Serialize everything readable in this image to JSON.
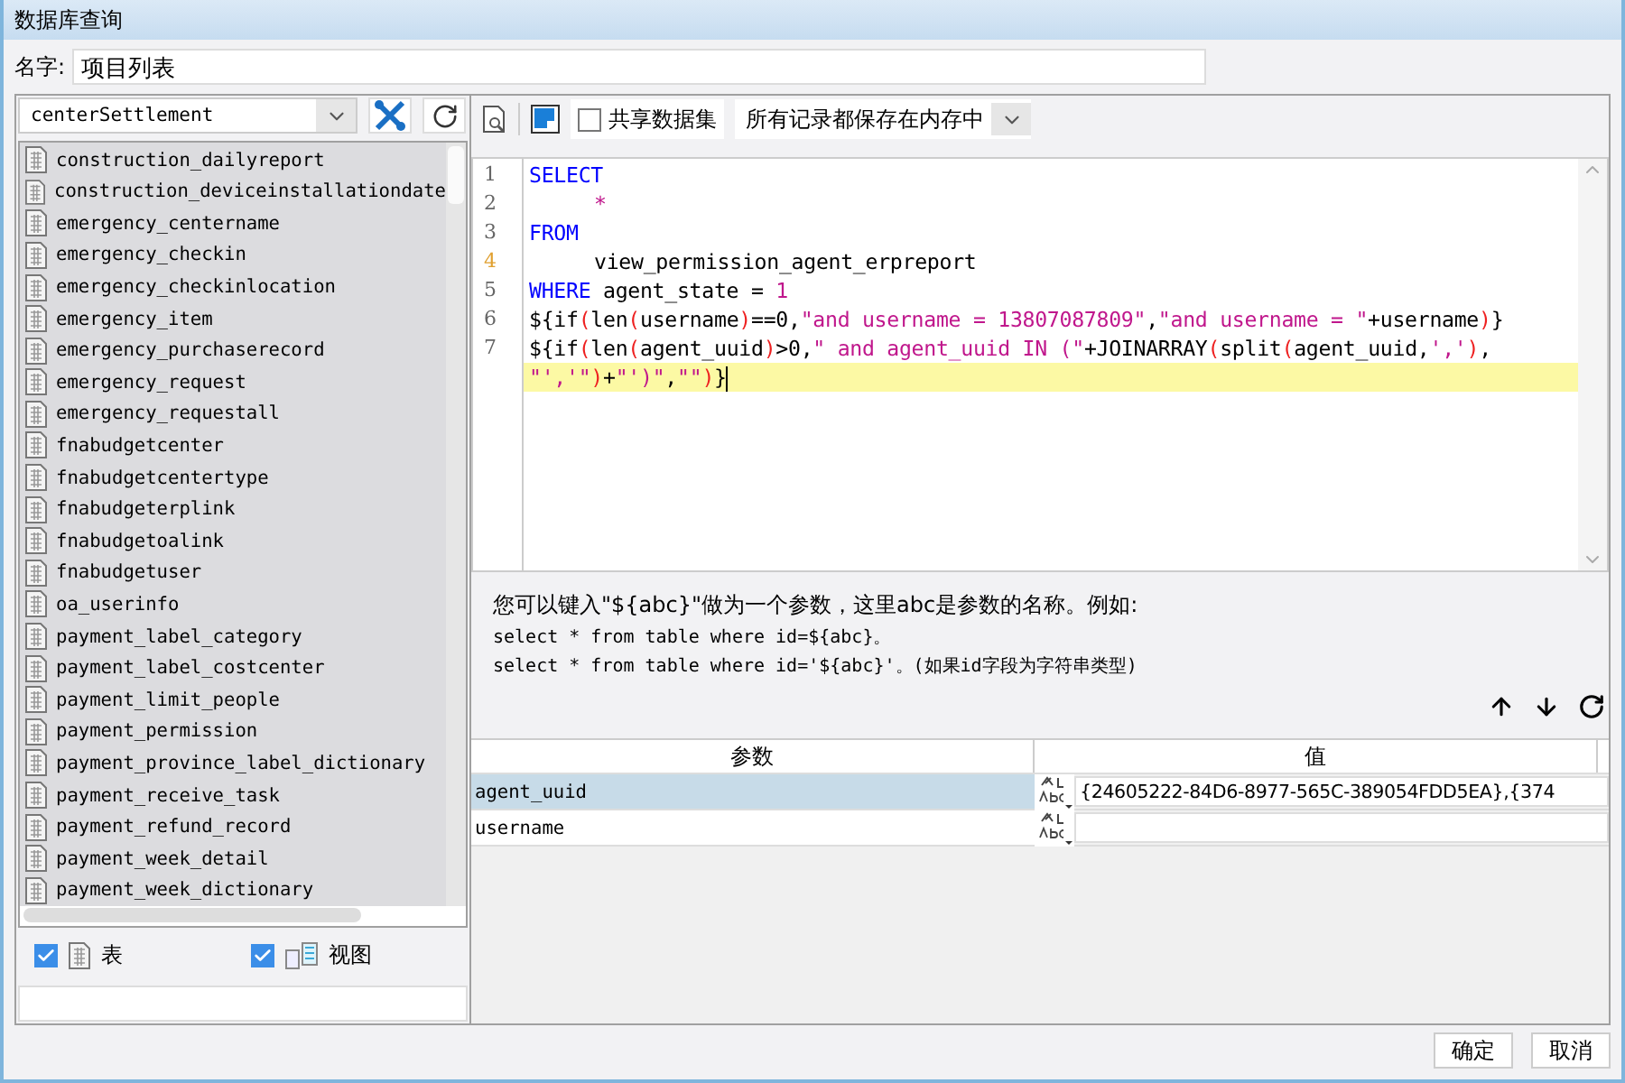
{
  "window": {
    "title": "数据库查询"
  },
  "name_field": {
    "label": "名字:",
    "value": "项目列表"
  },
  "connection": {
    "value": "centerSettlement"
  },
  "tables": [
    {
      "name": "construction_dailyreport"
    },
    {
      "name": "construction_deviceinstallationdate"
    },
    {
      "name": "emergency_centername"
    },
    {
      "name": "emergency_checkin"
    },
    {
      "name": "emergency_checkinlocation"
    },
    {
      "name": "emergency_item"
    },
    {
      "name": "emergency_purchaserecord"
    },
    {
      "name": "emergency_request"
    },
    {
      "name": "emergency_requestall"
    },
    {
      "name": "fnabudgetcenter"
    },
    {
      "name": "fnabudgetcentertype"
    },
    {
      "name": "fnabudgeterplink"
    },
    {
      "name": "fnabudgetoalink"
    },
    {
      "name": "fnabudgetuser"
    },
    {
      "name": "oa_userinfo"
    },
    {
      "name": "payment_label_category"
    },
    {
      "name": "payment_label_costcenter"
    },
    {
      "name": "payment_limit_people"
    },
    {
      "name": "payment_permission"
    },
    {
      "name": "payment_province_label_dictionary"
    },
    {
      "name": "payment_receive_task"
    },
    {
      "name": "payment_refund_record"
    },
    {
      "name": "payment_week_detail"
    },
    {
      "name": "payment_week_dictionary"
    }
  ],
  "filters": [
    {
      "kind": "table",
      "label": "表",
      "checked": true
    },
    {
      "kind": "view",
      "label": "视图",
      "checked": true
    }
  ],
  "toolbar": {
    "share": {
      "label": "共享数据集",
      "checked": false
    },
    "storage": {
      "value": "所有记录都保存在内存中"
    }
  },
  "code_lines": [
    {
      "number": "1",
      "modified": false,
      "current": false,
      "tokens": [
        {
          "kind": "keyword",
          "text": "SELECT"
        }
      ]
    },
    {
      "number": "2",
      "modified": false,
      "current": false,
      "tokens": [
        {
          "kind": "indent"
        },
        {
          "kind": "symbol",
          "text": "*"
        }
      ]
    },
    {
      "number": "3",
      "modified": false,
      "current": false,
      "tokens": [
        {
          "kind": "keyword",
          "text": "FROM"
        }
      ]
    },
    {
      "number": "4",
      "modified": true,
      "current": false,
      "tokens": [
        {
          "kind": "indent"
        },
        {
          "kind": "text",
          "text": "view_permission_agent_erpreport"
        }
      ]
    },
    {
      "number": "5",
      "modified": false,
      "current": false,
      "tokens": [
        {
          "kind": "keyword",
          "text": "WHERE"
        },
        {
          "kind": "text",
          "text": " agent_state = "
        },
        {
          "kind": "string",
          "text": "1"
        }
      ]
    },
    {
      "number": "6",
      "modified": false,
      "current": false,
      "tokens": [
        {
          "kind": "text",
          "text": "${if"
        },
        {
          "kind": "paren",
          "text": "("
        },
        {
          "kind": "text",
          "text": "len"
        },
        {
          "kind": "paren",
          "text": "("
        },
        {
          "kind": "text",
          "text": "username"
        },
        {
          "kind": "paren",
          "text": ")"
        },
        {
          "kind": "text",
          "text": "==0,"
        },
        {
          "kind": "string",
          "text": "\"and username = 13807087809\""
        },
        {
          "kind": "text",
          "text": ","
        },
        {
          "kind": "string",
          "text": "\"and username = \""
        },
        {
          "kind": "text",
          "text": "+username"
        },
        {
          "kind": "paren",
          "text": ")"
        },
        {
          "kind": "text",
          "text": "}"
        }
      ]
    },
    {
      "number": "7",
      "modified": false,
      "current": false,
      "tokens": [
        {
          "kind": "text",
          "text": "${if"
        },
        {
          "kind": "paren",
          "text": "("
        },
        {
          "kind": "text",
          "text": "len"
        },
        {
          "kind": "paren",
          "text": "("
        },
        {
          "kind": "text",
          "text": "agent_uuid"
        },
        {
          "kind": "paren",
          "text": ")"
        },
        {
          "kind": "text",
          "text": ">0,"
        },
        {
          "kind": "string",
          "text": "\" and agent_uuid IN (\""
        },
        {
          "kind": "text",
          "text": "+JOINARRAY"
        },
        {
          "kind": "paren",
          "text": "("
        },
        {
          "kind": "text",
          "text": "split"
        },
        {
          "kind": "paren",
          "text": "("
        },
        {
          "kind": "text",
          "text": "agent_uuid,"
        },
        {
          "kind": "string",
          "text": "','"
        },
        {
          "kind": "paren",
          "text": ")"
        },
        {
          "kind": "text",
          "text": ","
        }
      ]
    },
    {
      "current": true,
      "modified": false,
      "tokens": [
        {
          "kind": "string",
          "text": "\"','\""
        },
        {
          "kind": "paren",
          "text": ")"
        },
        {
          "kind": "text",
          "text": "+"
        },
        {
          "kind": "string",
          "text": "\"')\""
        },
        {
          "kind": "text",
          "text": ","
        },
        {
          "kind": "string",
          "text": "\"\""
        },
        {
          "kind": "paren",
          "text": ")"
        },
        {
          "kind": "text",
          "text": "}"
        }
      ]
    }
  ],
  "help": {
    "intro": "您可以键入\"${abc}\"做为一个参数，这里abc是参数的名称。例如:",
    "examples": [
      "select * from table where id=${abc}。",
      "select * from table where id='${abc}'。(如果id字段为字符串类型)"
    ]
  },
  "params": {
    "columns": [
      "参数",
      "值"
    ],
    "rows": [
      {
        "name": "agent_uuid",
        "value": "{24605222-84D6-8977-565C-389054FDD5EA},{374",
        "selected": true
      },
      {
        "name": "username",
        "selected": false
      }
    ]
  },
  "buttons": [
    "确定",
    "取消"
  ]
}
